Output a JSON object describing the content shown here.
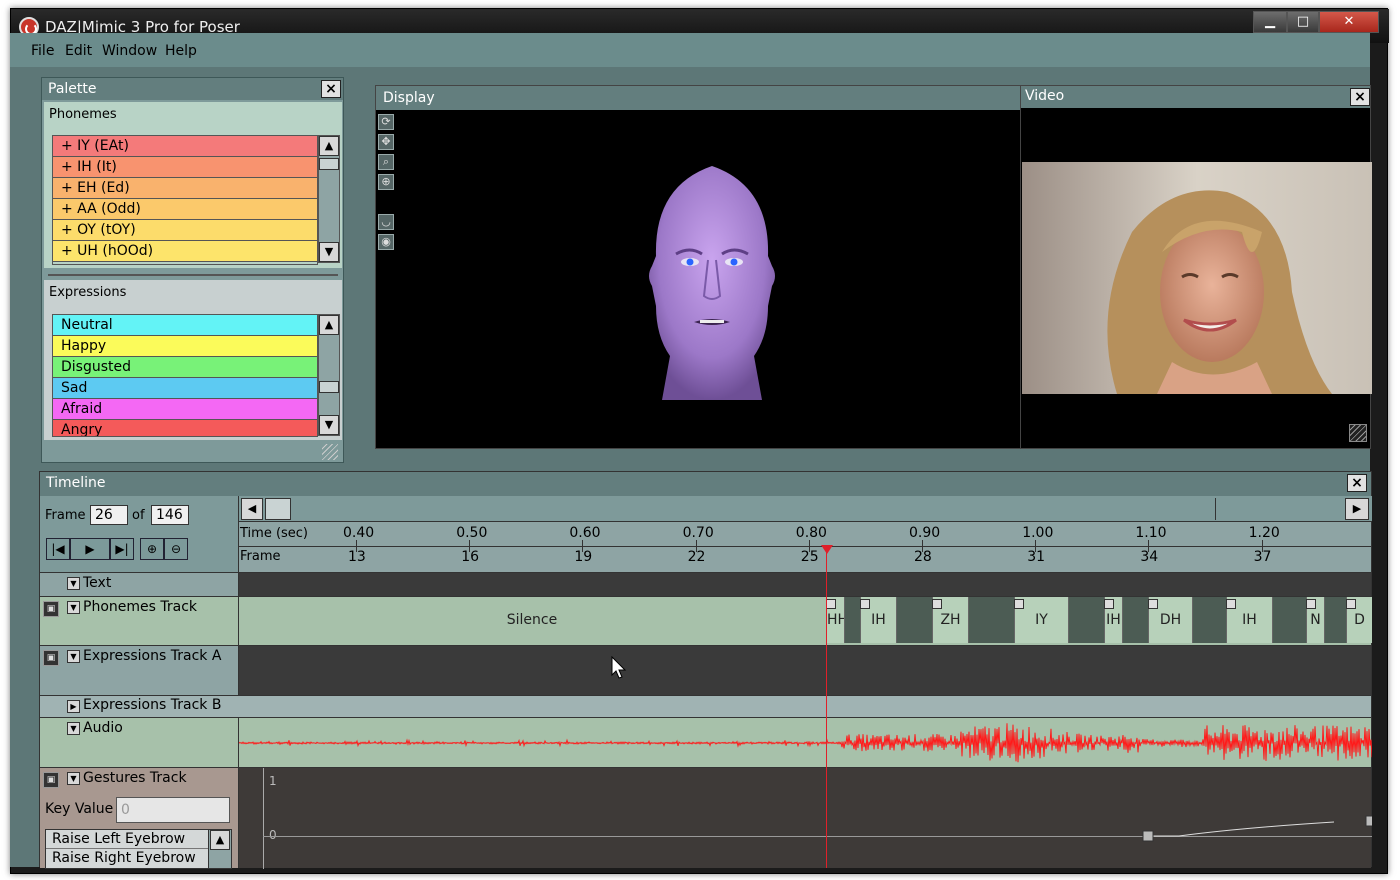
{
  "window": {
    "title": "DAZ|Mimic 3 Pro for Poser",
    "min": "▁",
    "max": "□",
    "close": "✕"
  },
  "menu": [
    "File",
    "Edit",
    "Window",
    "Help"
  ],
  "palette": {
    "title": "Palette",
    "phonemes_label": "Phonemes",
    "phonemes": [
      {
        "label": "+ IY  (EAt)",
        "color": "#f47a7a"
      },
      {
        "label": "+ IH  (It)",
        "color": "#f8936f"
      },
      {
        "label": "+ EH  (Ed)",
        "color": "#f9b26d"
      },
      {
        "label": "+ AA  (Odd)",
        "color": "#fbc96b"
      },
      {
        "label": "+ OY  (tOY)",
        "color": "#fcdc6b"
      },
      {
        "label": "+ UH  (hOOd)",
        "color": "#fde46b"
      }
    ],
    "expressions_label": "Expressions",
    "expressions": [
      {
        "label": "Neutral",
        "color": "#63f3f6"
      },
      {
        "label": "Happy",
        "color": "#fbfb5a"
      },
      {
        "label": "Disgusted",
        "color": "#78f278"
      },
      {
        "label": "Sad",
        "color": "#5dcaf2"
      },
      {
        "label": "Afraid",
        "color": "#f468f4"
      },
      {
        "label": "Angry",
        "color": "#f45a5a"
      }
    ]
  },
  "display": {
    "title": "Display"
  },
  "video": {
    "title": "Video"
  },
  "timeline": {
    "title": "Timeline",
    "frame_label": "Frame",
    "frame_value": "26",
    "of_label": "of",
    "frame_total": "146",
    "time_label": "Time (sec)",
    "frame_row_label": "Frame",
    "ticks": [
      {
        "time": "0.40",
        "frame": "13"
      },
      {
        "time": "0.50",
        "frame": "16"
      },
      {
        "time": "0.60",
        "frame": "19"
      },
      {
        "time": "0.70",
        "frame": "22"
      },
      {
        "time": "0.80",
        "frame": "25"
      },
      {
        "time": "0.90",
        "frame": "28"
      },
      {
        "time": "1.00",
        "frame": "31"
      },
      {
        "time": "1.10",
        "frame": "34"
      },
      {
        "time": "1.20",
        "frame": "37"
      }
    ],
    "tracks": {
      "text": "Text",
      "phonemes": "Phonemes Track",
      "expressions_a": "Expressions Track A",
      "expressions_b": "Expressions Track B",
      "audio": "Audio",
      "gestures": "Gestures Track"
    },
    "phoneme_blocks": [
      {
        "label": "Silence"
      },
      {
        "label": "HH"
      },
      {
        "label": "IH"
      },
      {
        "label": "ZH"
      },
      {
        "label": "IY"
      },
      {
        "label": "IH"
      },
      {
        "label": "DH"
      },
      {
        "label": "IH"
      },
      {
        "label": "N"
      },
      {
        "label": "D"
      }
    ],
    "key_value_label": "Key Value",
    "key_value_placeholder": "0",
    "gestures": [
      "Raise Left Eyebrow",
      "Raise Right Eyebrow"
    ],
    "gesture_axis": [
      "1",
      "0"
    ]
  },
  "colors": {
    "playhead": "#e0202a",
    "waveform": "#ff1a1a",
    "accent": "#637e7e"
  }
}
